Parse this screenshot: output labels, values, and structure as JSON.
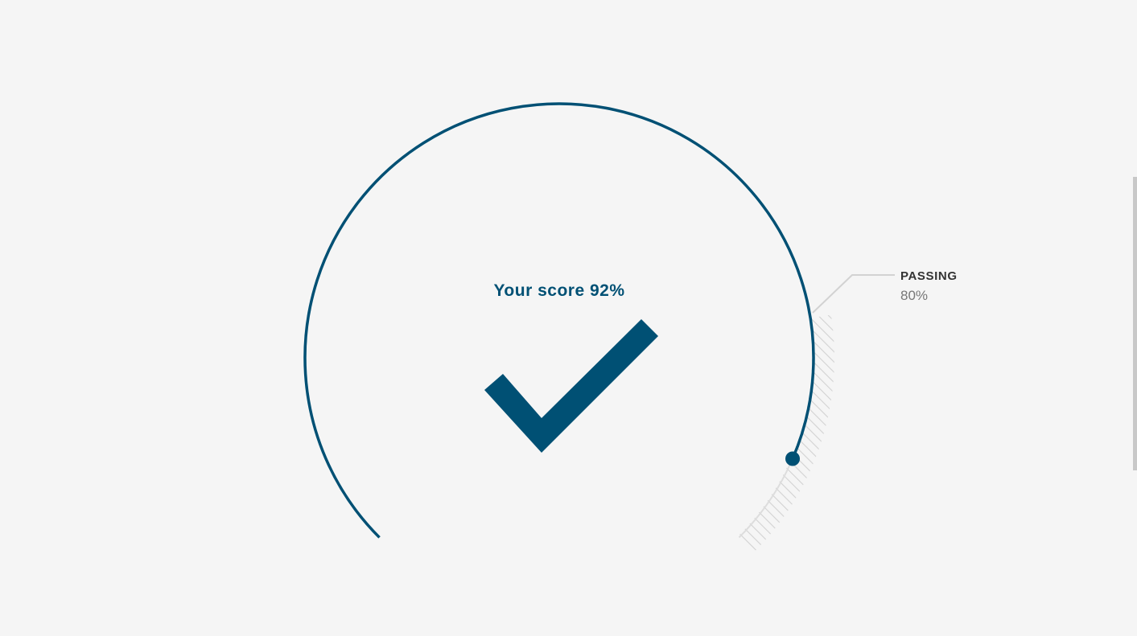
{
  "result": {
    "score_label": "Your score 92%",
    "score_fraction": 0.92,
    "status_icon": "checkmark-icon"
  },
  "passing": {
    "label": "PASSING",
    "value": "80%",
    "fraction": 0.8
  },
  "colors": {
    "accent": "#005074",
    "passing_zone": "#d2d2d2",
    "background": "#f5f5f5",
    "label_dark": "#333333",
    "label_muted": "#777777"
  }
}
